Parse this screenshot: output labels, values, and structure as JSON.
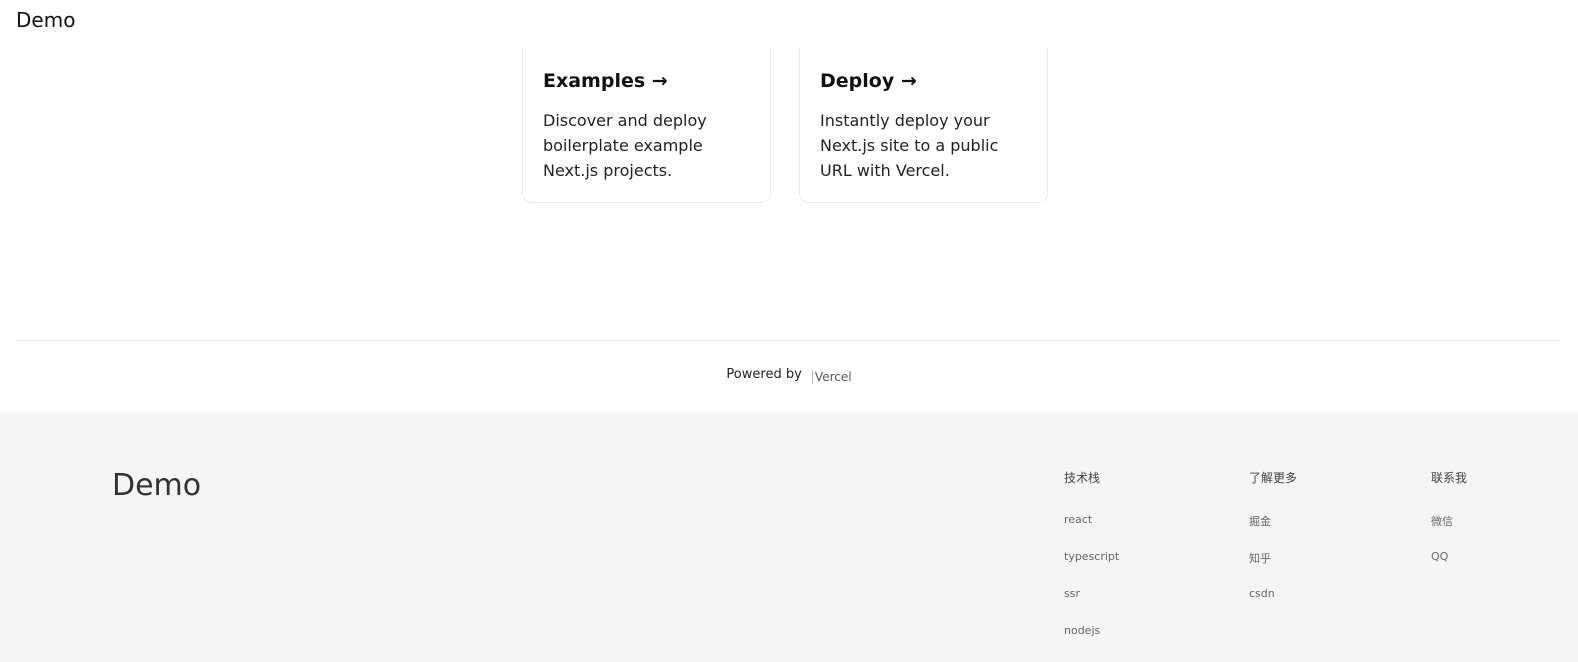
{
  "header": {
    "title": "Demo"
  },
  "cards": [
    {
      "title": "Examples →",
      "description": "Discover and deploy boilerplate example Next.js projects."
    },
    {
      "title": "Deploy →",
      "description": "Instantly deploy your Next.js site to a public URL with Vercel."
    }
  ],
  "powered": {
    "text": "Powered by",
    "logo_alt": "Vercel"
  },
  "footer": {
    "brand": "Demo",
    "columns": [
      {
        "title": "技术栈",
        "links": [
          "react",
          "typescript",
          "ssr",
          "nodejs"
        ]
      },
      {
        "title": "了解更多",
        "links": [
          "掘金",
          "知乎",
          "csdn"
        ]
      },
      {
        "title": "联系我",
        "links": [
          "微信",
          "QQ"
        ]
      }
    ]
  }
}
